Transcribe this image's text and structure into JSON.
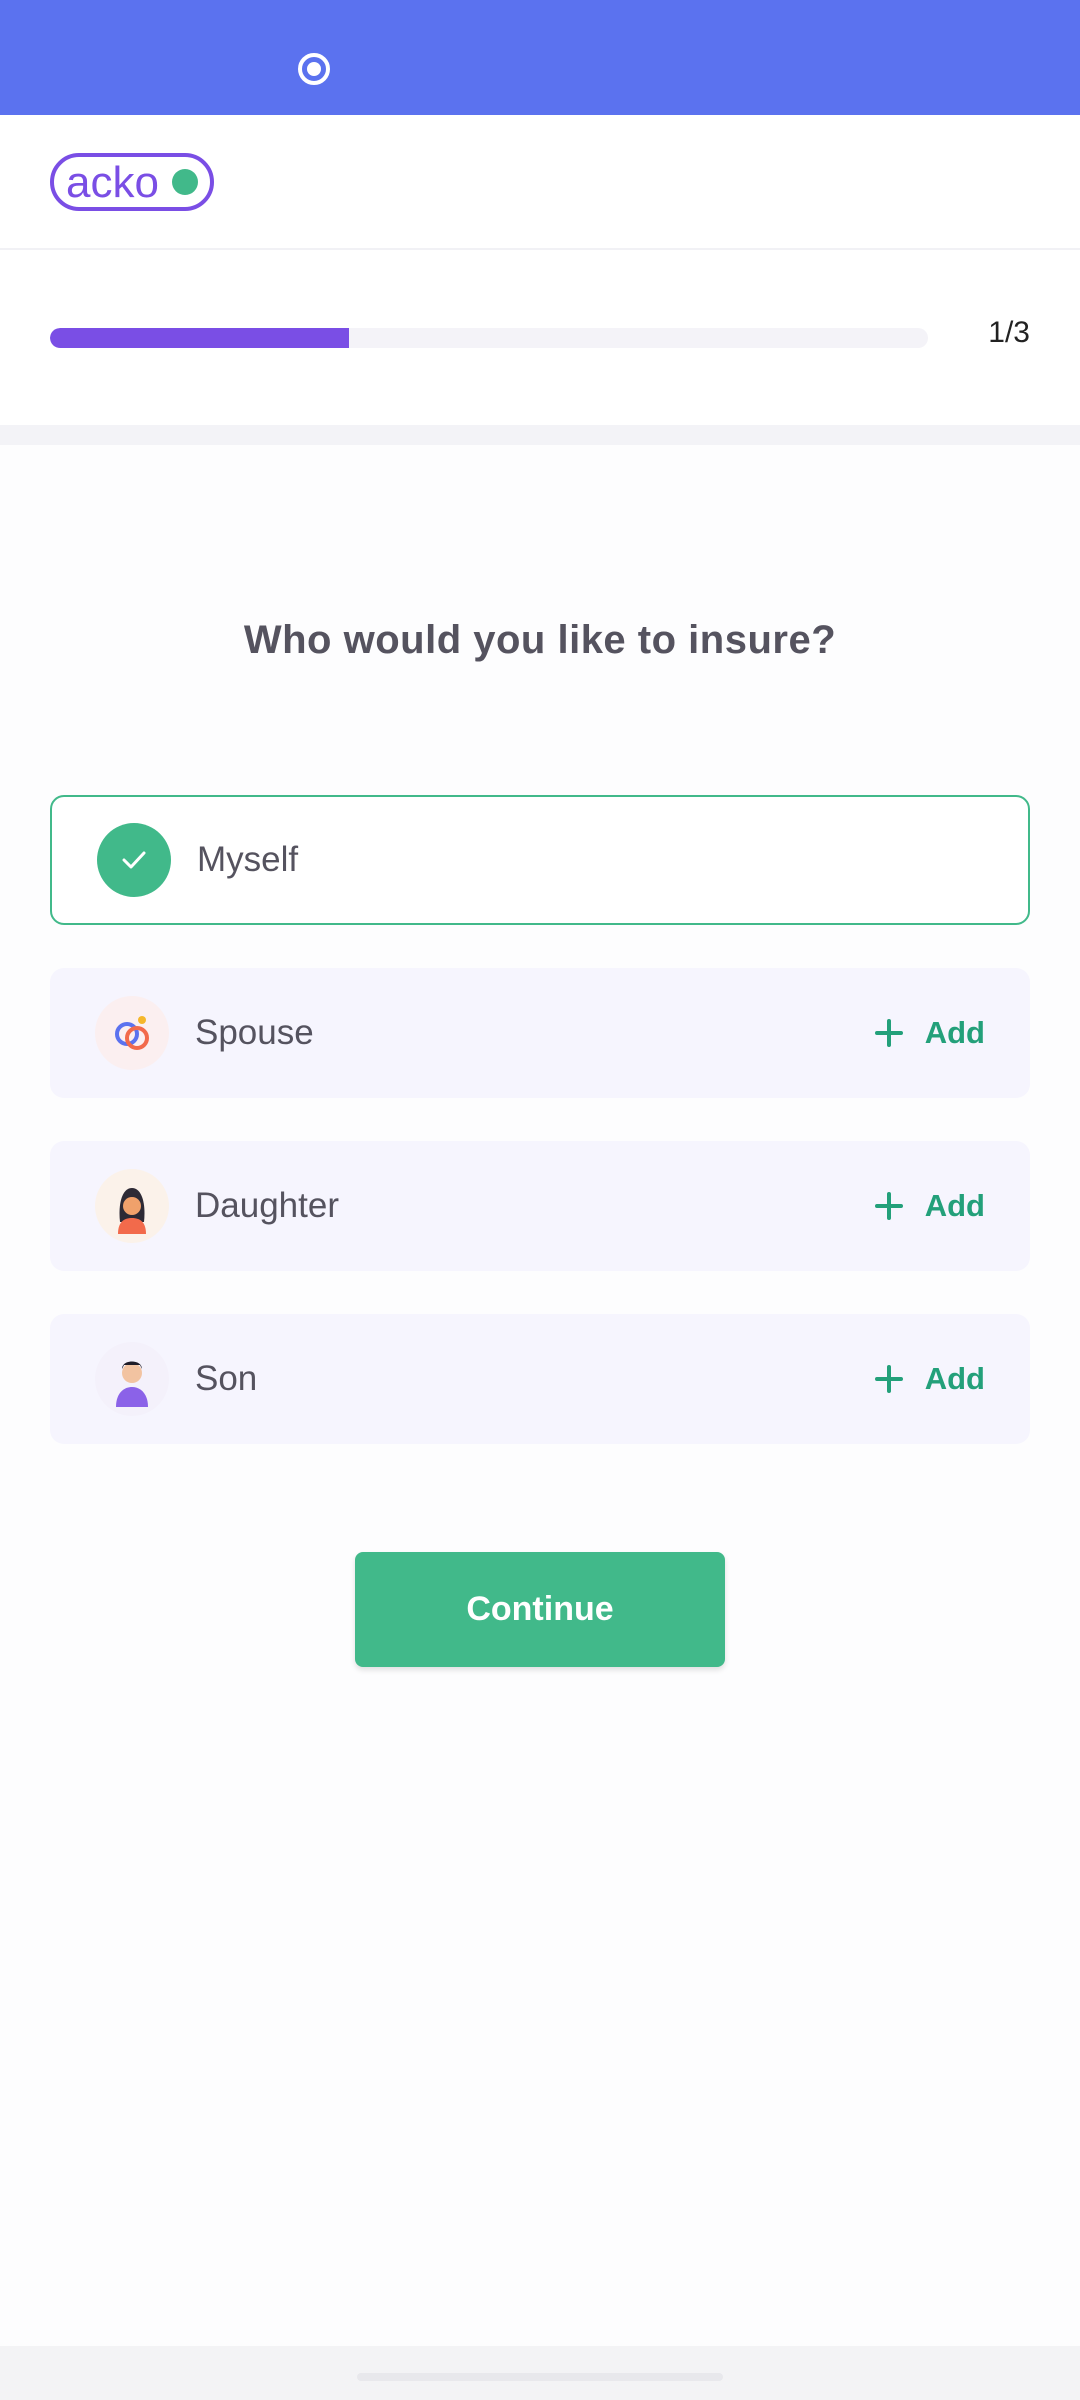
{
  "header": {
    "logo_text": "acko"
  },
  "progress": {
    "text": "1/3",
    "fraction": 0.34
  },
  "question": "Who would you like to insure?",
  "options": [
    {
      "label": "Myself",
      "icon": "check-icon",
      "selected": true
    },
    {
      "label": "Spouse",
      "icon": "rings-icon",
      "add_label": "Add"
    },
    {
      "label": "Daughter",
      "icon": "daughter-avatar-icon",
      "add_label": "Add"
    },
    {
      "label": "Son",
      "icon": "son-avatar-icon",
      "add_label": "Add"
    }
  ],
  "continue_label": "Continue",
  "colors": {
    "brand": "#5b72ef",
    "accent_green": "#41b98a",
    "progress": "#7a4ee5"
  }
}
